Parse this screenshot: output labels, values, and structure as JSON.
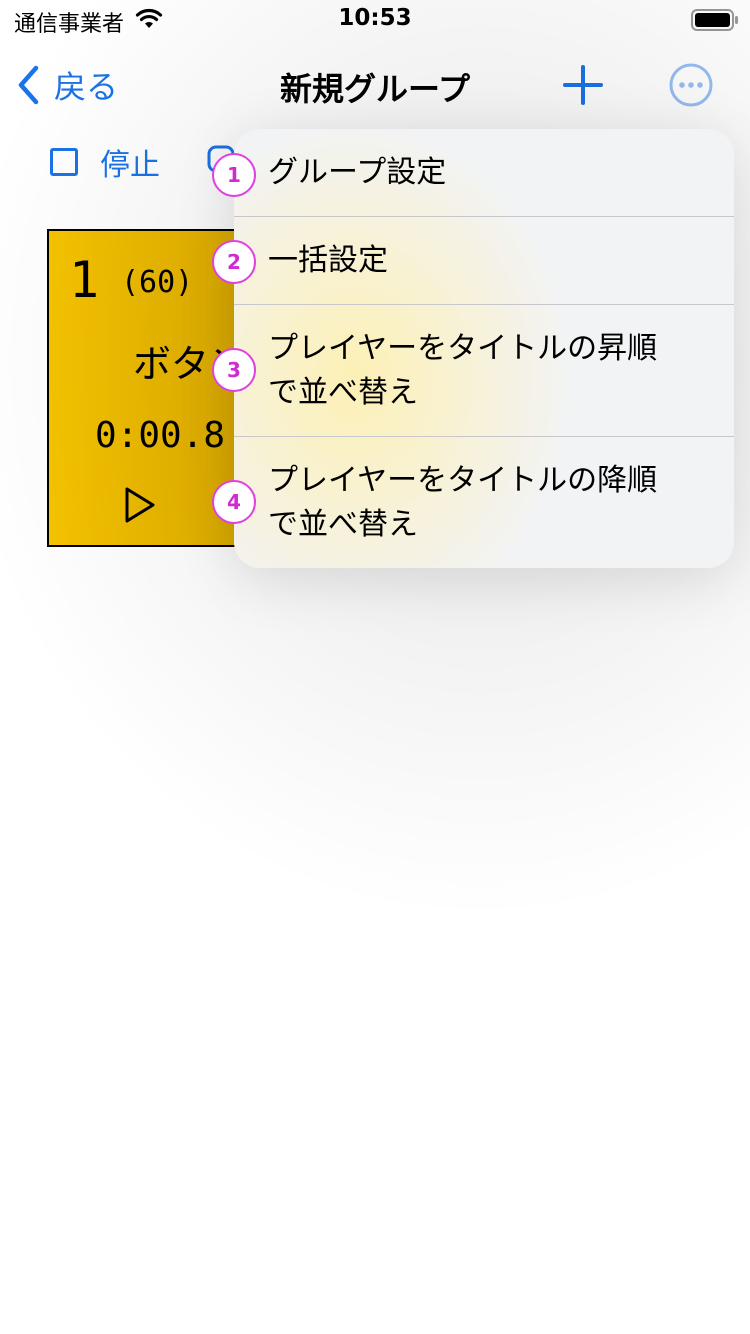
{
  "status_bar": {
    "carrier": "通信事業者",
    "time": "10:53",
    "icons": [
      "wifi-icon",
      "battery-icon"
    ]
  },
  "nav": {
    "back_label": "戻る",
    "title": "新規グループ",
    "add_icon": "plus-icon",
    "more_icon": "ellipsis-circle-icon"
  },
  "toolbar": {
    "stop_label": "停止"
  },
  "player_card": {
    "number": "1",
    "count": "(60)",
    "title": "ボタン",
    "time": "0:00.8",
    "play_icon": "play-icon"
  },
  "menu": {
    "items": [
      {
        "badge": "1",
        "label": "グループ設定"
      },
      {
        "badge": "2",
        "label": "一括設定"
      },
      {
        "badge": "3",
        "label_line1": "プレイヤーをタイトルの昇順",
        "label_line2": "で並べ替え"
      },
      {
        "badge": "4",
        "label_line1": "プレイヤーをタイトルの降順",
        "label_line2": "で並べ替え"
      }
    ]
  },
  "colors": {
    "accent": "#1a73e8",
    "card": "#f6c400",
    "badge": "#e040e0"
  }
}
